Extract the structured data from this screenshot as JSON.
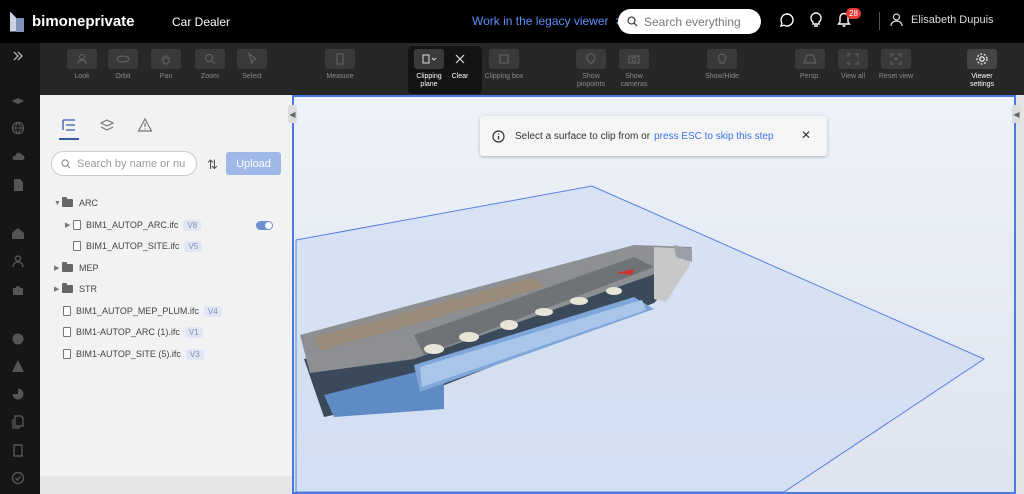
{
  "app": {
    "name": "bimoneprivate",
    "project": "Car Dealer"
  },
  "header": {
    "legacy_link": "Work in the legacy viewer",
    "search_placeholder": "Search everything",
    "notification_count": "28",
    "user_name": "Elisabeth Dupuis"
  },
  "toolbar": {
    "tools": [
      {
        "id": "look",
        "label": "Look"
      },
      {
        "id": "orbit",
        "label": "Orbit"
      },
      {
        "id": "pan",
        "label": "Pan"
      },
      {
        "id": "zoom",
        "label": "Zoom"
      },
      {
        "id": "select",
        "label": "Select"
      },
      {
        "id": "measure",
        "label": "Measure"
      },
      {
        "id": "clipping-plane",
        "label": "Clipping plane"
      },
      {
        "id": "clear",
        "label": "Clear"
      },
      {
        "id": "clipping-box",
        "label": "Clipping box"
      },
      {
        "id": "show-pinpoints",
        "label": "Show pinpoints"
      },
      {
        "id": "show-cameras",
        "label": "Show cameras"
      },
      {
        "id": "show-hide",
        "label": "Show/Hide"
      },
      {
        "id": "persp",
        "label": "Persp."
      },
      {
        "id": "view-all",
        "label": "View all"
      },
      {
        "id": "reset-view",
        "label": "Reset view"
      },
      {
        "id": "viewer-settings",
        "label": "Viewer settings"
      }
    ]
  },
  "panel": {
    "search_placeholder": "Search by name or nu",
    "upload_label": "Upload",
    "tree": [
      {
        "type": "folder",
        "name": "ARC",
        "expanded": true
      },
      {
        "type": "file",
        "name": "BIM1_AUTOP_ARC.ifc",
        "version": "V8",
        "has_toggle": true
      },
      {
        "type": "file",
        "name": "BIM1_AUTOP_SITE.ifc",
        "version": "V5"
      },
      {
        "type": "folder",
        "name": "MEP",
        "expanded": false
      },
      {
        "type": "folder",
        "name": "STR",
        "expanded": false
      },
      {
        "type": "file",
        "name": "BIM1_AUTOP_MEP_PLUM.ifc",
        "version": "V4"
      },
      {
        "type": "file",
        "name": "BIM1-AUTOP_ARC (1).ifc",
        "version": "V1"
      },
      {
        "type": "file",
        "name": "BIM1-AUTOP_SITE (5).ifc",
        "version": "V3"
      }
    ]
  },
  "viewer": {
    "toast": {
      "message": "Select a surface to clip from or",
      "link": "press ESC to skip this step"
    }
  },
  "colors": {
    "accent": "#4b79e0",
    "link": "#5b8ff9",
    "badge": "#e53935"
  }
}
